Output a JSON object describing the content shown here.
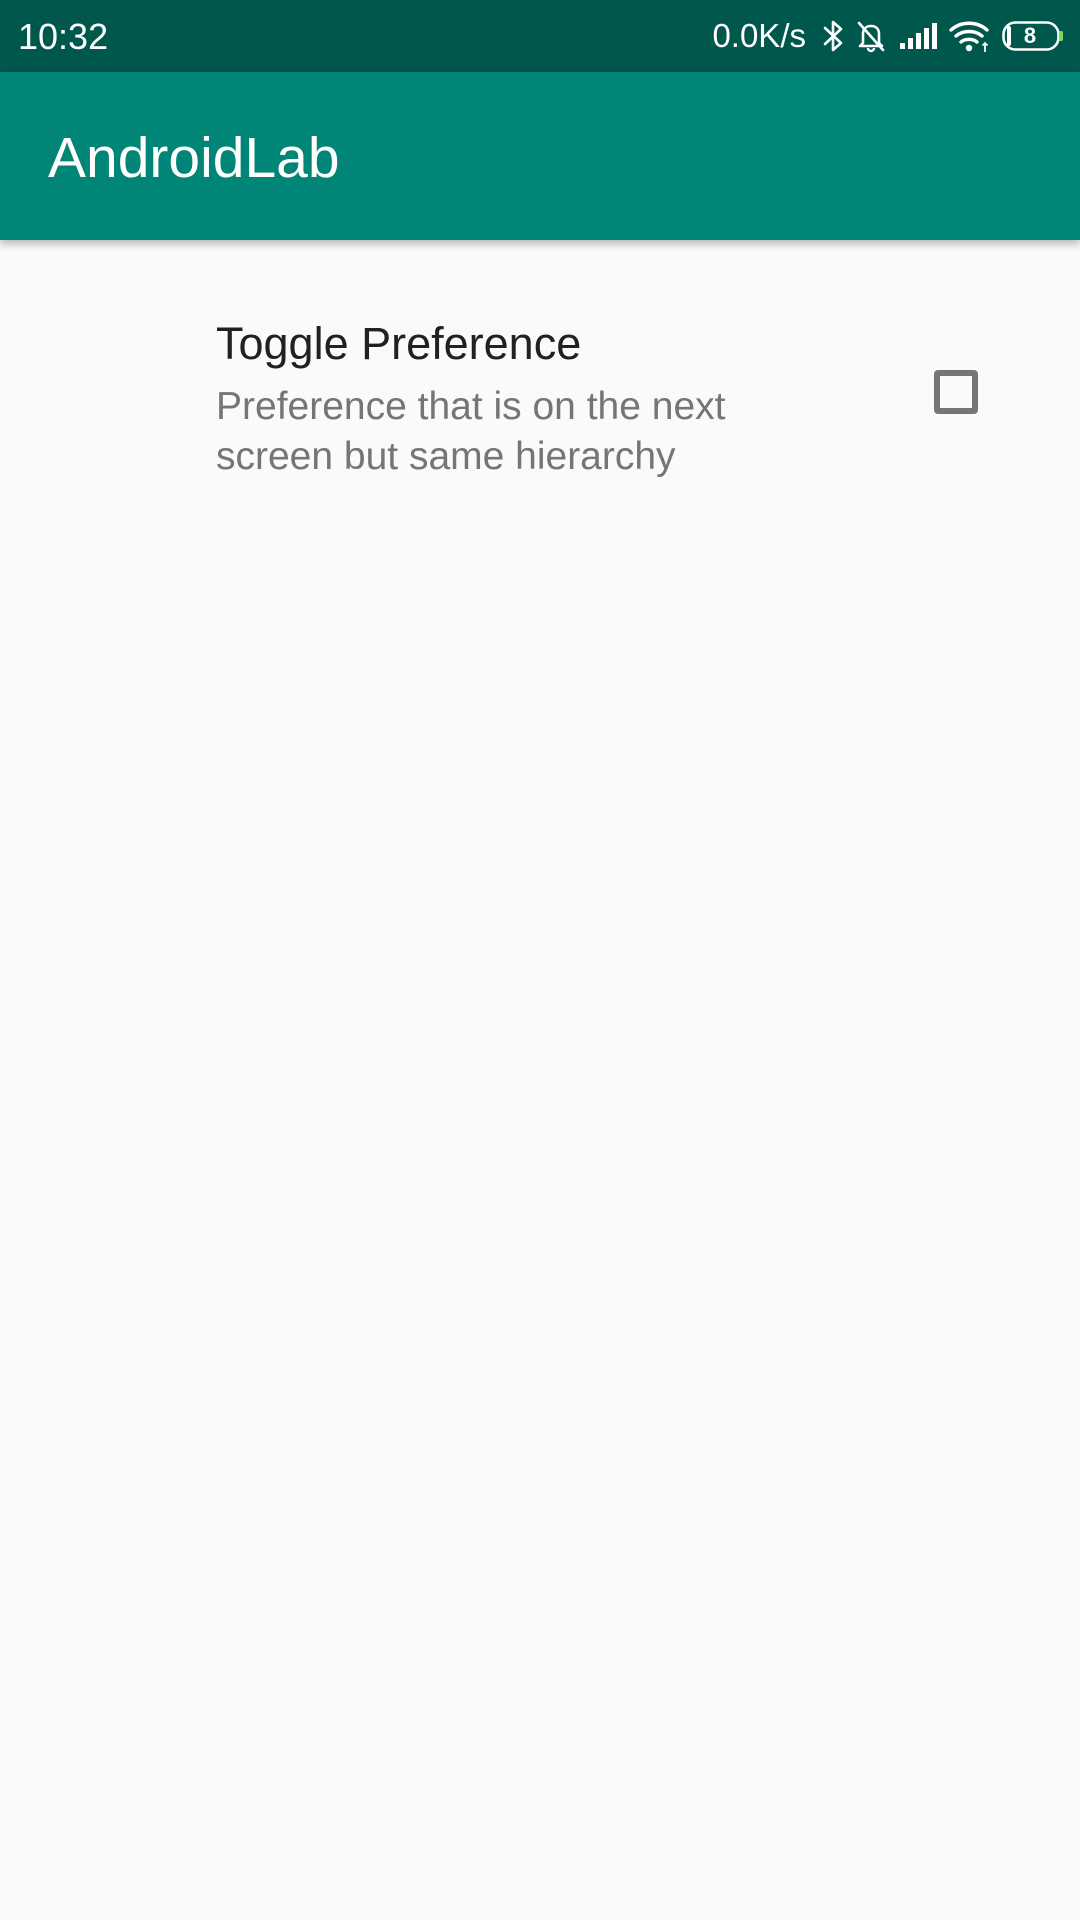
{
  "status_bar": {
    "time": "10:32",
    "net_speed": "0.0K/s",
    "battery_level": "8",
    "icons": [
      "bluetooth-icon",
      "notifications-off-icon",
      "signal-icon",
      "wifi-icon",
      "battery-icon"
    ]
  },
  "app_bar": {
    "title": "AndroidLab"
  },
  "preference": {
    "title": "Toggle Preference",
    "summary": "Preference that is on the next screen but same hierarchy",
    "checked": false
  },
  "colors": {
    "status_bar": "#00574b",
    "app_bar": "#008577",
    "background": "#fafafa",
    "title_text": "#212121",
    "summary_text": "#757575",
    "checkbox_border": "#757575"
  }
}
